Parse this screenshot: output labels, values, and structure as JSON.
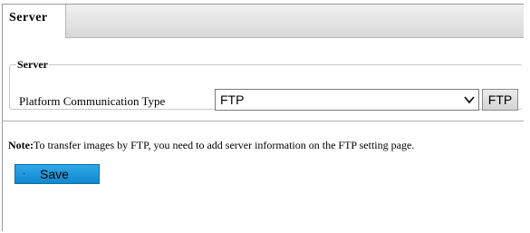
{
  "tabs": [
    {
      "label": "Server"
    }
  ],
  "section": {
    "legend": "Server",
    "platform_label": "Platform Communication Type",
    "platform_value": "FTP",
    "ftp_button": "FTP"
  },
  "note": {
    "prefix": "Note:",
    "text": "To transfer images by FTP, you need to add server information on the FTP setting page."
  },
  "actions": {
    "save_label": "Save",
    "save_bullet": "·"
  },
  "icons": {
    "select_arrow": "chevron-down-icon"
  },
  "colors": {
    "save_button": "#1e96db",
    "tabbar": "#dcdcdc"
  }
}
